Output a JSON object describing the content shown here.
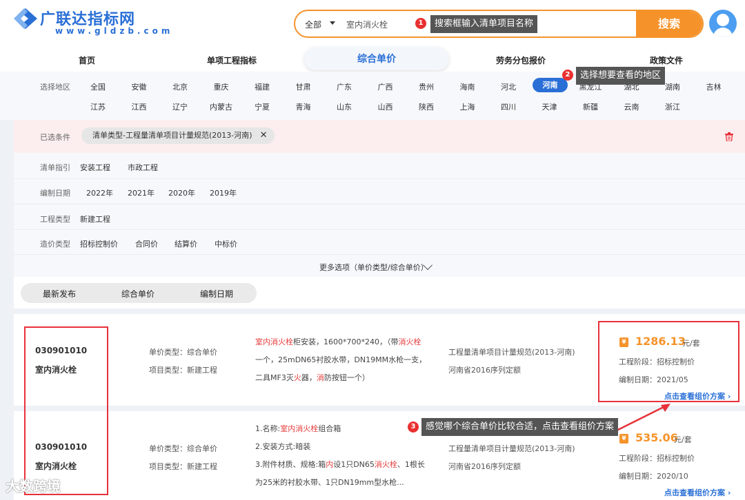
{
  "logo": {
    "title": "广联达指标网",
    "sub": "www.gldzb.com"
  },
  "search": {
    "category": "全部",
    "value": "室内消火栓",
    "button": "搜索"
  },
  "tips": {
    "t1": {
      "num": "1",
      "text": "搜索框输入清单项目名称"
    },
    "t2": {
      "num": "2",
      "text": "选择想要查看的地区"
    },
    "t3": {
      "num": "3",
      "text": "感觉哪个综合单价比较合适，点击查看组价方案"
    }
  },
  "nav": {
    "items": [
      "首页",
      "单项工程指标",
      "综合单价",
      "劳务分包报价",
      "政策文件"
    ],
    "active": "综合单价"
  },
  "region": {
    "label": "选择地区",
    "row1": [
      "全国",
      "安徽",
      "北京",
      "重庆",
      "福建",
      "甘肃",
      "广东",
      "广西",
      "贵州",
      "海南",
      "河北",
      "河南",
      "黑龙江",
      "湖北",
      "湖南",
      "吉林"
    ],
    "row2": [
      "江苏",
      "江西",
      "辽宁",
      "内蒙古",
      "宁夏",
      "青海",
      "山东",
      "山西",
      "陕西",
      "上海",
      "四川",
      "天津",
      "新疆",
      "云南",
      "浙江"
    ],
    "active": "河南"
  },
  "selected": {
    "label": "已选条件",
    "chip": "清单类型-工程量清单项目计量规范(2013-河南)",
    "close": "✕"
  },
  "filters": {
    "guide": {
      "label": "清单指引",
      "options": [
        "安装工程",
        "市政工程"
      ]
    },
    "date": {
      "label": "编制日期",
      "options": [
        "2022年",
        "2021年",
        "2020年",
        "2019年"
      ]
    },
    "type": {
      "label": "工程类型",
      "options": [
        "新建工程"
      ]
    },
    "cost": {
      "label": "造价类型",
      "options": [
        "招标控制价",
        "合同价",
        "结算价",
        "中标价"
      ]
    },
    "more": "更多选项（单价类型/综合单价）"
  },
  "sort": {
    "items": [
      "最新发布",
      "综合单价",
      "编制日期"
    ]
  },
  "results": [
    {
      "code": "030901010",
      "name": "室内消火栓",
      "price_type": "单价类型：综合单价",
      "project_type": "项目类型：新建工程",
      "desc1_a": "室内消火栓",
      "desc1_b": "柜安装，1600*700*240，（带",
      "desc1_c": "消火栓",
      "desc2": "一个，25mDN65衬胶水带，DN19MM水枪一支，",
      "desc3_a": "二具MF3灭",
      "desc3_b": "火",
      "desc3_c": "器，",
      "desc3_d": "消",
      "desc3_e": "防按钮一个）",
      "norm1": "工程量清单项目计量规范(2013-河南)",
      "norm2": "河南省2016序列定额",
      "price": "1286.13",
      "unit": "元/套",
      "stage": "工程阶段：招标控制价",
      "date": "编制日期：2021/05",
      "link": "点击查看组价方案 ›"
    },
    {
      "code": "030901010",
      "name": "室内消火栓",
      "price_type": "单价类型：综合单价",
      "project_type": "项目类型：新建工程",
      "desc1_a": "1.名称:",
      "desc1_b": "室内消火栓",
      "desc1_c": "组合箱",
      "desc2": "2.安装方式:暗装",
      "desc3_a": "3.附件材质、规格:箱",
      "desc3_b": "内",
      "desc3_c": "设1只DN65",
      "desc3_d": "消火栓",
      "desc3_e": "、1根长",
      "desc4": "为25米的衬胶水带、1只DN19mm型水枪...",
      "norm1": "工程量清单项目计量规范(2013-河南)",
      "norm2": "河南省2016序列定额",
      "price": "535.06",
      "unit": "元/套",
      "stage": "工程阶段：招标控制价",
      "date": "编制日期：2020/10",
      "link": "点击查看组价方案 ›"
    }
  ],
  "watermark": "大数跨境",
  "colors": {
    "accent": "#2a6fd6",
    "orange": "#f5932a",
    "highlight": "#e63a3a"
  }
}
